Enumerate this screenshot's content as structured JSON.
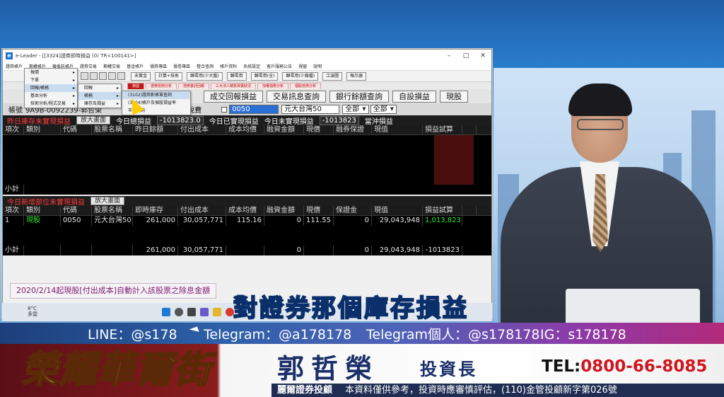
{
  "window": {
    "title": "e-Leader - [[3324]證券即時損益 (0) TR<100141>]",
    "controls": [
      "–",
      "□",
      "✕"
    ]
  },
  "menubar": [
    "證券帳戶",
    "期權帳戶",
    "複委託帳戶",
    "證券交易",
    "期權交易",
    "基金帳戶",
    "債券專區",
    "債卷專區",
    "整合查詢",
    "帳戶資料",
    "系統設定",
    "客戶服務公告",
    "視窗",
    "說明"
  ],
  "toolbar": {
    "buttons": [
      "未實金",
      "計算+技術",
      "歸零用(少大盤)",
      "歸零用",
      "歸零用(全)",
      "歸零用(少幾檔)",
      "江波圖",
      "報示器"
    ]
  },
  "tabs": [
    "損益",
    "證券技術分析",
    "證券委託回報",
    "三大法人期貨買賣狀況",
    "加權指數分析",
    "個股技術分析"
  ],
  "quick_buttons": [
    "成交回報損益",
    "交易訊息查詢",
    "銀行餘額查詢",
    "自設損益",
    "現股"
  ],
  "filter": {
    "account": "帳號",
    "account_value": "9A9B-0092239-郭哲榮",
    "tax_label": "損益不含稅費",
    "code_value": "0050",
    "stock_name": "元大台灣50",
    "all_label_1": "全部",
    "all_label_2": "全部"
  },
  "menus": {
    "level1": [
      "報價",
      "下單",
      "回報/帳務",
      "基本分析",
      "技術分析/程式交易"
    ],
    "level2": [
      "回報",
      "帳務",
      "庫存及損益"
    ],
    "level3": [
      "(3102)證券對帳單查詢",
      "(3104)帳戶及個股損益率",
      "市值查詢"
    ]
  },
  "section1": {
    "title": "昨日庫存未實現損益",
    "zoom": "放大畫面",
    "realized_label": "今日總損益",
    "realized_value": "-1013823.0",
    "today_label": "今日已實現損益",
    "today_value": "",
    "unreal_label": "今日未實現損益",
    "unreal_value": "-1013823",
    "charge_label": "當沖損益",
    "columns": [
      "項次",
      "類別",
      "代碼",
      "股票名稱",
      "昨日餘額",
      "付出成本",
      "成本均價",
      "融資金額",
      "現價",
      "融券保證",
      "現值",
      "損益試算"
    ],
    "subtotal_label": "小計"
  },
  "section2": {
    "title": "今日新增部位未實現損益",
    "zoom": "放大畫面",
    "columns": [
      "項次",
      "類別",
      "代碼",
      "股票名稱",
      "即時庫存",
      "付出成本",
      "成本均價",
      "融資金額",
      "現價",
      "保證金",
      "現值",
      "損益試算"
    ],
    "rows": [
      {
        "idx": "1",
        "type": "現股",
        "code": "0050",
        "name": "元大台灣50",
        "qty": "261,000",
        "cost": "30,057,771",
        "avg": "115.16",
        "margin": "0",
        "price": "111.55",
        "deposit": "0",
        "value": "29,043,948",
        "pnl": "1,013,823"
      }
    ],
    "subtotal": {
      "label": "小計",
      "qty": "261,000",
      "cost": "30,057,771",
      "margin": "0",
      "deposit": "0",
      "value": "29,043,948",
      "pnl": "-1013823"
    }
  },
  "notice": "2020/2/14起現股[付出成本]自動計入該股票之除息金額",
  "taskbar": {
    "weather_temp": "8°C",
    "weather_desc": "多雲"
  },
  "subtitle": "對證券那個庫存損益",
  "social": {
    "line": "LINE：@s178",
    "telegram": "Telegram：@a178178",
    "telegram_personal": "Telegram個人：@s178178",
    "ig": "IG：s178178"
  },
  "brand": "榮耀華爾街",
  "host": {
    "name": "郭哲榮",
    "title": "投資長"
  },
  "phone": {
    "prefix": "TEL:",
    "number": "0800-66-8085"
  },
  "ticker": {
    "company": "麗爾證券投顧",
    "disclaimer": "本資料僅供參考，投資時應審慎評估，(110)金管投顧新字第026號"
  },
  "colors": {
    "accent_red": "#c01616",
    "profit_green": "#2ee62e",
    "host_blue": "#1a2f6a",
    "phone_red": "#d1161e"
  }
}
